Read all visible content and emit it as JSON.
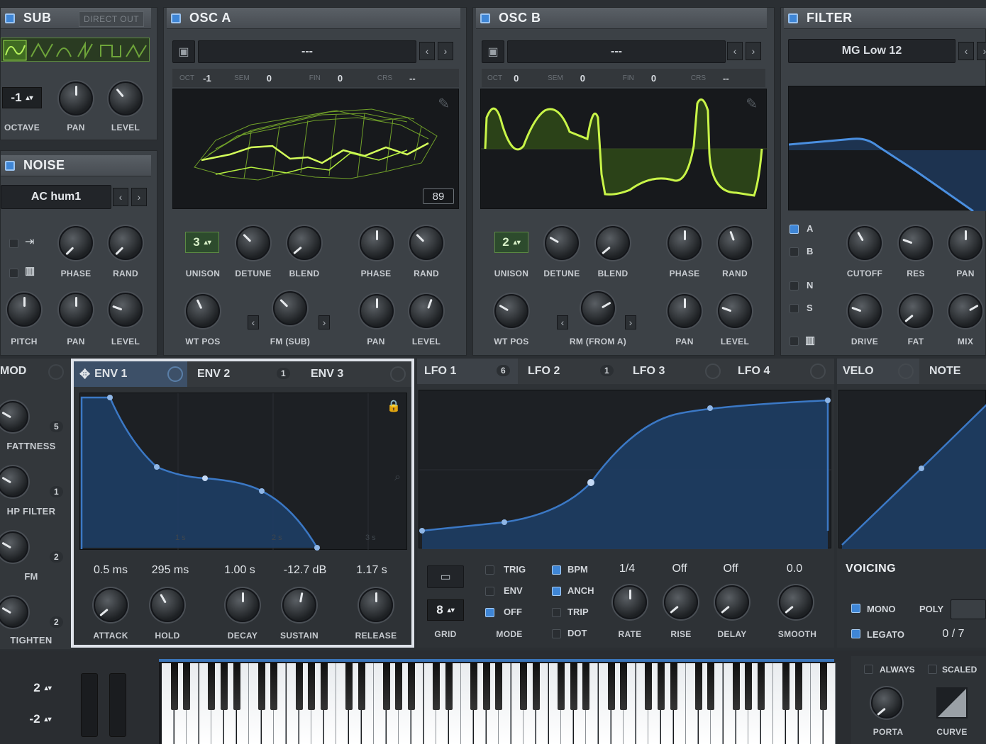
{
  "sub": {
    "title": "SUB",
    "direct_out": "DIRECT OUT",
    "octave_value": "-1",
    "labels": [
      "OCTAVE",
      "PAN",
      "LEVEL"
    ]
  },
  "noise": {
    "title": "NOISE",
    "preset": "AC hum1",
    "labels_row1": [
      "PHASE",
      "RAND"
    ],
    "labels_row2": [
      "PITCH",
      "PAN",
      "LEVEL"
    ]
  },
  "osc_a": {
    "title": "OSC A",
    "preset": "---",
    "oct_label": "OCT",
    "oct": "-1",
    "sem_label": "SEM",
    "sem": "0",
    "fin_label": "FIN",
    "fin": "0",
    "crs_label": "CRS",
    "crs": "--",
    "frame": "89",
    "unison": "3",
    "labels_row1": [
      "UNISON",
      "DETUNE",
      "BLEND",
      "PHASE",
      "RAND"
    ],
    "labels_row2": [
      "WT POS",
      "FM (SUB)",
      "PAN",
      "LEVEL"
    ]
  },
  "osc_b": {
    "title": "OSC B",
    "preset": "---",
    "oct_label": "OCT",
    "oct": "0",
    "sem_label": "SEM",
    "sem": "0",
    "fin_label": "FIN",
    "fin": "0",
    "crs_label": "CRS",
    "crs": "--",
    "unison": "2",
    "labels_row1": [
      "UNISON",
      "DETUNE",
      "BLEND",
      "PHASE",
      "RAND"
    ],
    "labels_row2": [
      "WT POS",
      "RM (FROM A)",
      "PAN",
      "LEVEL"
    ]
  },
  "filter": {
    "title": "FILTER",
    "type": "MG Low 12",
    "routes": [
      "A",
      "B",
      "N",
      "S"
    ],
    "labels_row1": [
      "CUTOFF",
      "RES",
      "PAN"
    ],
    "labels_row2": [
      "DRIVE",
      "FAT",
      "MIX"
    ]
  },
  "mod": {
    "title": "MOD",
    "items": [
      {
        "label": "FATTNESS",
        "count": "5"
      },
      {
        "label": "HP FILTER",
        "count": "1"
      },
      {
        "label": "FM",
        "count": "2"
      },
      {
        "label": "TIGHTEN",
        "count": "2"
      }
    ]
  },
  "env": {
    "tabs": [
      {
        "label": "ENV 1",
        "count": ""
      },
      {
        "label": "ENV 2",
        "count": "1"
      },
      {
        "label": "ENV 3",
        "count": ""
      }
    ],
    "grid_labels": [
      "1 s",
      "2 s",
      "3 s"
    ],
    "values": [
      "0.5 ms",
      "295 ms",
      "1.00 s",
      "-12.7 dB",
      "1.17 s"
    ],
    "labels": [
      "ATTACK",
      "HOLD",
      "DECAY",
      "SUSTAIN",
      "RELEASE"
    ]
  },
  "lfo": {
    "tabs": [
      {
        "label": "LFO 1",
        "count": "6"
      },
      {
        "label": "LFO 2",
        "count": "1"
      },
      {
        "label": "LFO 3",
        "count": ""
      },
      {
        "label": "LFO 4",
        "count": ""
      }
    ],
    "grid_value": "8",
    "grid_label": "GRID",
    "mode_label": "MODE",
    "mode_options": [
      "TRIG",
      "ENV",
      "OFF"
    ],
    "flags": [
      "BPM",
      "ANCH",
      "TRIP",
      "DOT"
    ],
    "rate": "1/4",
    "rise": "Off",
    "delay": "Off",
    "smooth": "0.0",
    "knob_labels": [
      "RATE",
      "RISE",
      "DELAY",
      "SMOOTH"
    ]
  },
  "velo": {
    "tabs": [
      "VELO",
      "NOTE"
    ]
  },
  "voicing": {
    "title": "VOICING",
    "mono": "MONO",
    "poly": "POLY",
    "legato": "LEGATO",
    "voices": "0 / 7"
  },
  "keyboard": {
    "pitch_up": "2",
    "pitch_down": "-2"
  },
  "porta": {
    "always": "ALWAYS",
    "scaled": "SCALED",
    "porta": "PORTA",
    "curve": "CURVE"
  }
}
